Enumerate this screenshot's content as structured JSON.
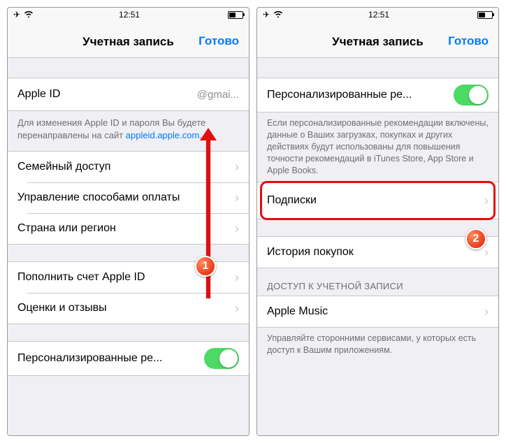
{
  "status": {
    "time": "12:51"
  },
  "nav": {
    "title": "Учетная запись",
    "done": "Готово"
  },
  "left": {
    "apple_id_label": "Apple ID",
    "apple_id_value": "@gmai...",
    "footer_text": "Для изменения Apple ID и пароля Вы будете перенаправлены на сайт ",
    "footer_link": "appleid.apple.com",
    "family": "Семейный доступ",
    "payment": "Управление способами оплаты",
    "country": "Страна или регион",
    "topup": "Пополнить счет Apple ID",
    "reviews": "Оценки и отзывы",
    "personalized": "Персонализированные ре..."
  },
  "right": {
    "personalized": "Персонализированные ре...",
    "personalized_desc": "Если персонализированные рекомендации включены, данные о Ваших загрузках, покупках и других действиях будут использованы для повышения точности рекомендаций в iTunes Store, App Store и Apple Books.",
    "subscriptions": "Подписки",
    "purchase_history": "История покупок",
    "access_header": "ДОСТУП К УЧЕТНОЙ ЗАПИСИ",
    "apple_music": "Apple Music",
    "access_desc": "Управляйте сторонними сервисами, у которых есть доступ к Вашим приложениям."
  },
  "badges": {
    "one": "1",
    "two": "2"
  }
}
